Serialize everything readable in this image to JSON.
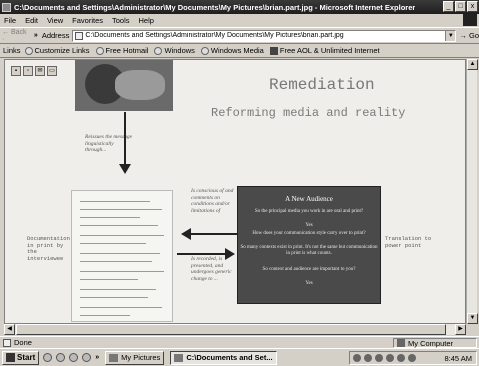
{
  "window": {
    "title": "C:\\Documents and Settings\\Administrator\\My Documents\\My Pictures\\brian.part.jpg - Microsoft Internet Explorer",
    "controls": [
      "_",
      "□",
      "x"
    ]
  },
  "menu": [
    "File",
    "Edit",
    "View",
    "Favorites",
    "Tools",
    "Help"
  ],
  "address": {
    "back_label": "← Back ·",
    "label": "Address",
    "url": "C:\\Documents and Settings\\Administrator\\My Documents\\My Pictures\\brian.part.jpg",
    "go_label": "Go"
  },
  "links": {
    "label": "Links",
    "items": [
      "Customize Links",
      "Free Hotmail",
      "Windows",
      "Windows Media",
      "Free AOL & Unlimited Internet"
    ]
  },
  "slide_image": {
    "heading": "Remediation",
    "subheading": "Reforming media and reality",
    "note_top_left": "Reissues the message linguistically through...",
    "note_mid_top": "Is conscious of and comments on conditions and/or limitations of",
    "note_mid_bottom": "Is recorded, is presented, and undergoes generic change to ...",
    "label_left": "Documentation in print by the interviewee",
    "label_right": "Translation to power point",
    "slide": {
      "title": "A New Audience",
      "lines": [
        "So the principal media you work in are oral and print?",
        "Yes",
        "How does your communication style carry over to print?",
        "So many contexts exist in print. It's not the same but communication in print is what counts.",
        "So context and audience are important to you?",
        "Yes"
      ]
    }
  },
  "status": {
    "text": "Done",
    "zone": "My Computer"
  },
  "taskbar": {
    "start": "Start",
    "tasks": [
      "My Pictures",
      "C:\\Documents and Set..."
    ],
    "clock": "8:45 AM"
  },
  "icons": {
    "toolbar": [
      "save-icon",
      "print-icon",
      "email-icon",
      "folder-icon"
    ]
  }
}
